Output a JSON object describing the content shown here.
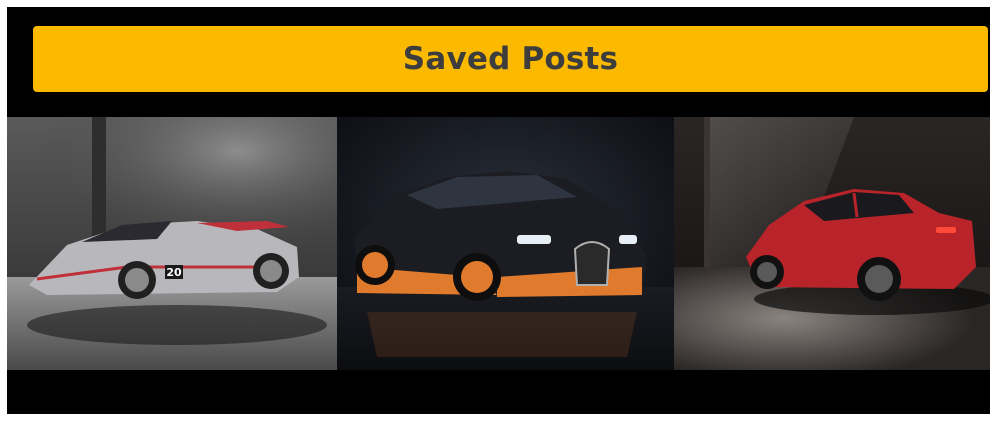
{
  "header": {
    "title": "Saved Posts"
  },
  "colors": {
    "accent": "#fbba00",
    "background": "#000000",
    "title_text": "#3d3d3d"
  },
  "posts": [
    {
      "subject": "silver-hypercar-roadster",
      "plate_number": "20"
    },
    {
      "subject": "black-orange-hypercar"
    },
    {
      "subject": "red-sport-sedan"
    }
  ]
}
